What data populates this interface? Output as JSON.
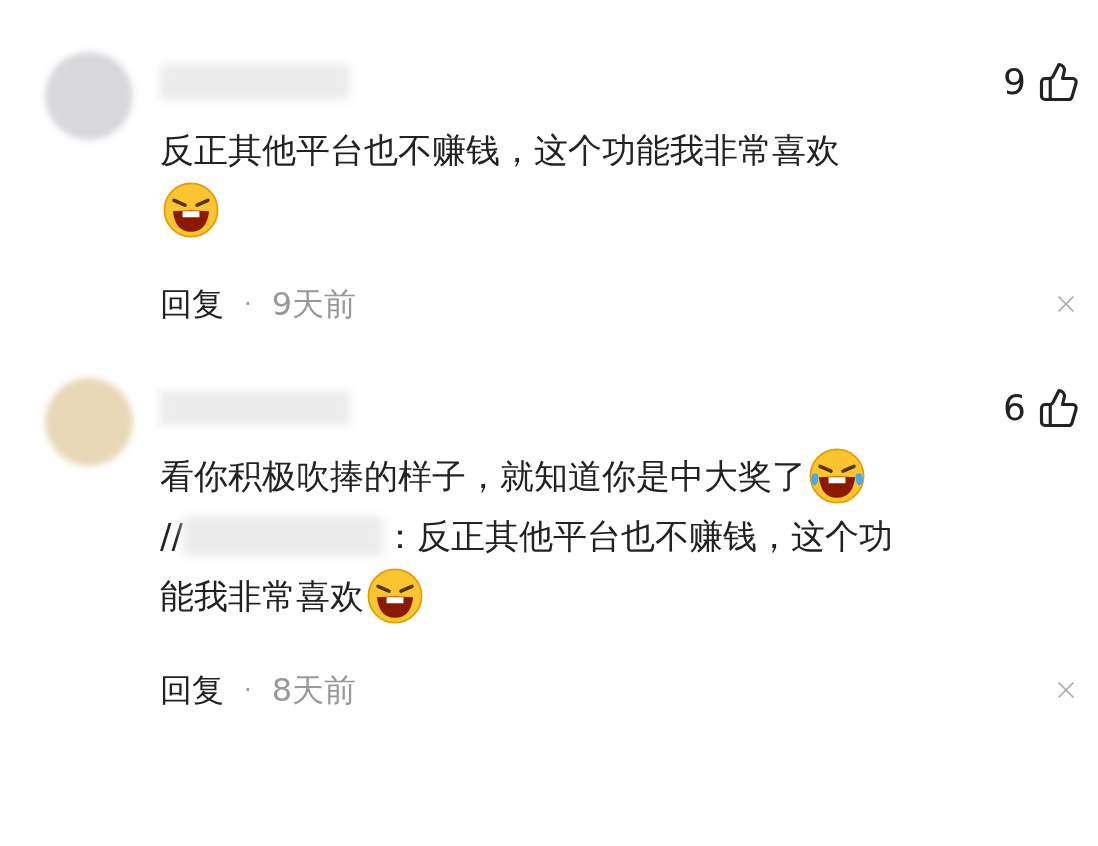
{
  "comments": [
    {
      "likes": "9",
      "lines": [
        [
          {
            "kind": "text",
            "text": "反正其他平台也不赚钱，这个功能我非常喜欢"
          }
        ],
        [
          {
            "kind": "grin"
          }
        ]
      ],
      "reply": "回复",
      "separator": "·",
      "time": "9天前"
    },
    {
      "likes": "6",
      "lines": [
        [
          {
            "kind": "text",
            "text": "看你积极吹捧的样子，就知道你是中大奖了"
          },
          {
            "kind": "tears"
          }
        ],
        [
          {
            "kind": "text",
            "text": "//"
          },
          {
            "kind": "redacted"
          },
          {
            "kind": "text",
            "text": "：反正其他平台也不赚钱，这个功"
          }
        ],
        [
          {
            "kind": "text",
            "text": "能我非常喜欢"
          },
          {
            "kind": "grin"
          }
        ]
      ],
      "reply": "回复",
      "separator": "·",
      "time": "8天前"
    }
  ]
}
